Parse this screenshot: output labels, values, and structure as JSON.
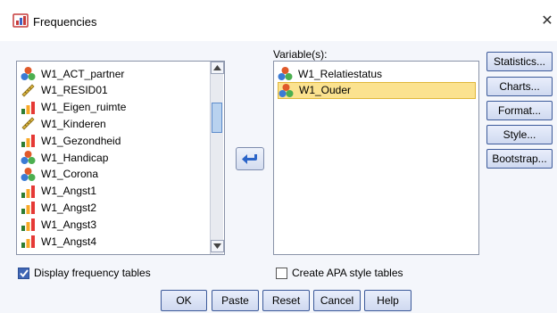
{
  "window": {
    "title": "Frequencies",
    "close_symbol": "✕"
  },
  "source_list": {
    "items": [
      {
        "label": "W1_ACT_partner",
        "icon": "nominal-icon"
      },
      {
        "label": "W1_RESID01",
        "icon": "scale-icon"
      },
      {
        "label": "W1_Eigen_ruimte",
        "icon": "ordinal-icon"
      },
      {
        "label": "W1_Kinderen",
        "icon": "scale-icon"
      },
      {
        "label": "W1_Gezondheid",
        "icon": "ordinal-icon"
      },
      {
        "label": "W1_Handicap",
        "icon": "nominal-icon"
      },
      {
        "label": "W1_Corona",
        "icon": "nominal-icon"
      },
      {
        "label": "W1_Angst1",
        "icon": "ordinal-icon"
      },
      {
        "label": "W1_Angst2",
        "icon": "ordinal-icon"
      },
      {
        "label": "W1_Angst3",
        "icon": "ordinal-icon"
      },
      {
        "label": "W1_Angst4",
        "icon": "ordinal-icon"
      }
    ]
  },
  "variables": {
    "label": "Variable(s):",
    "items": [
      {
        "label": "W1_Relatiestatus",
        "icon": "nominal-icon",
        "selected": false
      },
      {
        "label": "W1_Ouder",
        "icon": "nominal-icon",
        "selected": true
      }
    ]
  },
  "side_buttons": {
    "statistics": "Statistics...",
    "charts": "Charts...",
    "format": "Format...",
    "style": "Style...",
    "bootstrap": "Bootstrap..."
  },
  "options": {
    "display_frequency_tables": {
      "label": "Display frequency tables",
      "checked": true
    },
    "create_apa_tables": {
      "label": "Create APA style tables",
      "checked": false
    }
  },
  "bottom_buttons": {
    "ok": "OK",
    "paste": "Paste",
    "reset": "Reset",
    "cancel": "Cancel",
    "help": "Help"
  },
  "colors": {
    "selection": "#fbe28f",
    "accent": "#3f66b5",
    "nominal_top": "#e05a2a",
    "nominal_left": "#3b7bd4",
    "nominal_right": "#4caf50",
    "scale": "#d8b23a",
    "ordinal_bars": [
      "#2e7d32",
      "#f9a825",
      "#e53935"
    ]
  }
}
